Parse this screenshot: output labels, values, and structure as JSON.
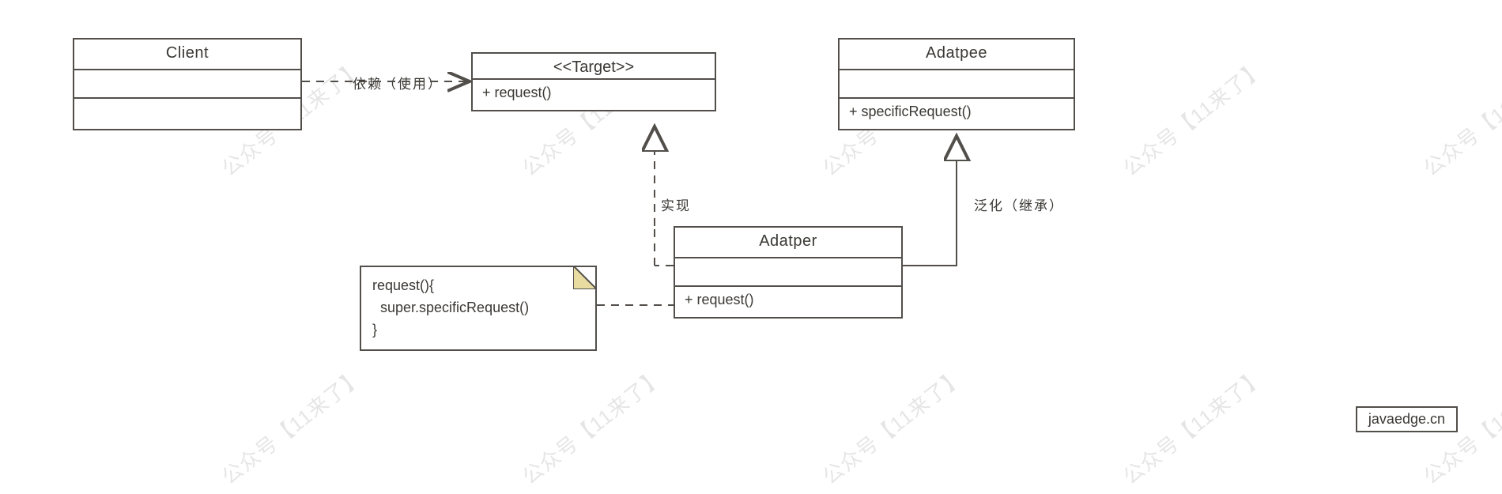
{
  "watermark_text": "公众号【11来了】",
  "badge": "javaedge.cn",
  "boxes": {
    "client": {
      "title": "Client",
      "attrs": "",
      "ops": ""
    },
    "target": {
      "stereo": "<<Target>>",
      "ops": "+ request()"
    },
    "adaptee": {
      "title": "Adatpee",
      "attrs": "",
      "ops": "+ specificRequest()"
    },
    "adapter": {
      "title": "Adatper",
      "attrs": "",
      "ops": "+ request()"
    }
  },
  "note": {
    "line1": "request(){",
    "line2": "  super.specificRequest()",
    "line3": "}"
  },
  "labels": {
    "depends": "依赖（使用）",
    "realize": "实现",
    "general": "泛化（继承）"
  }
}
